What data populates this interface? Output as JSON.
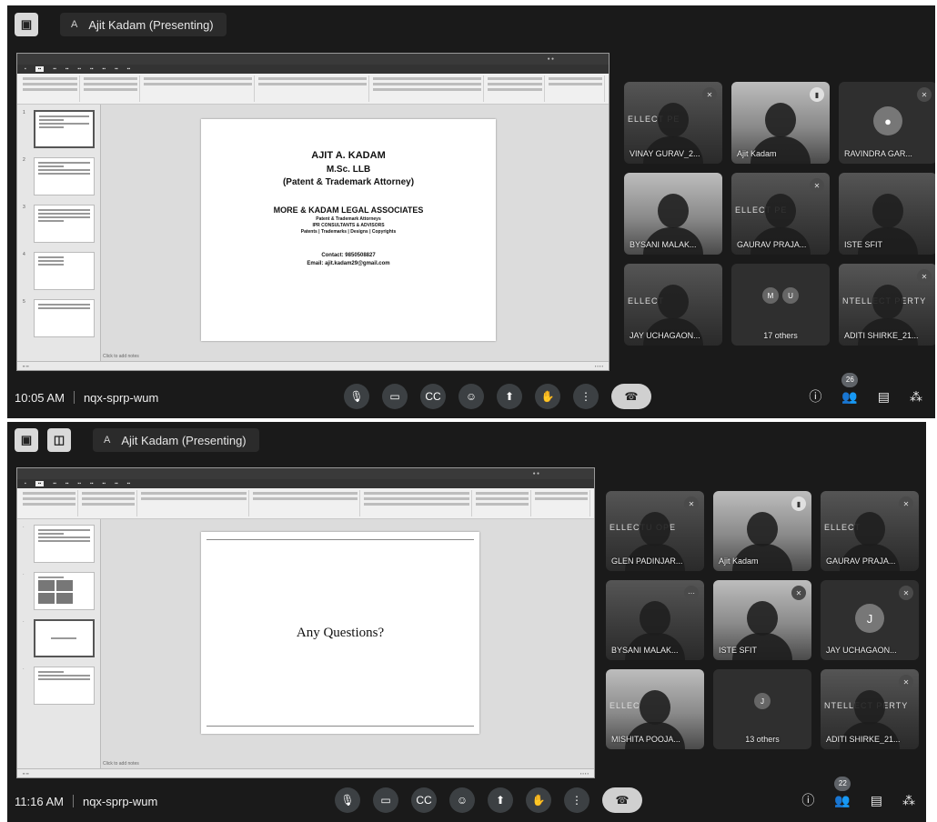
{
  "sessions": [
    {
      "presenter": "Ajit Kadam (Presenting)",
      "presenter_initial": "A",
      "time": "10:05 AM",
      "meeting_code": "nqx-sprp-wum",
      "participant_count": "26",
      "slide": {
        "name": "AJIT A. KADAM",
        "degree": "M.Sc. LLB",
        "role": "(Patent & Trademark Attorney)",
        "firm": "MORE & KADAM LEGAL ASSOCIATES",
        "sub1": "Patent & Trademark Attorneys",
        "sub2": "IPR CONSULTANTS & ADVISORS",
        "sub3": "Patents | Trademarks | Designs | Copyrights",
        "contact": "Contact: 9850508827",
        "email": "Email: ajit.kadam29@gmail.com"
      },
      "notes": "Click to add notes",
      "tiles": [
        {
          "name": "VINAY GURAV_2...",
          "banner": "ELLECT   PE"
        },
        {
          "name": "Ajit Kadam"
        },
        {
          "name": "RAVINDRA GAR..."
        },
        {
          "name": "BYSANI MALAK..."
        },
        {
          "name": "GAURAV PRAJA...",
          "banner": "ELLECT     PE"
        },
        {
          "name": "ISTE SFIT"
        },
        {
          "name": "JAY UCHAGAON...",
          "banner": "ELLECT"
        },
        {
          "name": "17 others",
          "initials": [
            "M",
            "U"
          ]
        },
        {
          "name": "ADITI SHIRKE_21...",
          "banner": "NTELLECT     PERTY"
        }
      ]
    },
    {
      "presenter": "Ajit Kadam (Presenting)",
      "presenter_initial": "A",
      "time": "11:16 AM",
      "meeting_code": "nqx-sprp-wum",
      "participant_count": "22",
      "slide": {
        "question": "Any Questions?"
      },
      "notes": "Click to add notes",
      "tiles": [
        {
          "name": "GLEN PADINJAR...",
          "banner": "ELLECTU   OPE"
        },
        {
          "name": "Ajit Kadam"
        },
        {
          "name": "GAURAV PRAJA...",
          "banner": "ELLECT"
        },
        {
          "name": "BYSANI MALAK..."
        },
        {
          "name": "ISTE SFIT"
        },
        {
          "name": "JAY UCHAGAON...",
          "initial": "J"
        },
        {
          "name": "MISHITA POOJA...",
          "banner": "ELLEC"
        },
        {
          "name": "13 others",
          "initials": [
            "J"
          ]
        },
        {
          "name": "ADITI SHIRKE_21...",
          "banner": "NTELLECT    PERTY"
        }
      ]
    }
  ],
  "icons": {
    "mic": "mic-off-icon",
    "camera": "camera-icon",
    "captions": "captions-icon",
    "emoji": "emoji-icon",
    "present": "present-icon",
    "hand": "raise-hand-icon",
    "more": "more-icon",
    "hangup": "hangup-icon",
    "info": "info-icon",
    "people": "people-icon",
    "chat": "chat-icon",
    "activities": "activities-icon"
  },
  "colors": {
    "meet_bg": "#1a1a1a",
    "tile_bg": "#3a3a3a",
    "control_bg": "#3c4043"
  }
}
